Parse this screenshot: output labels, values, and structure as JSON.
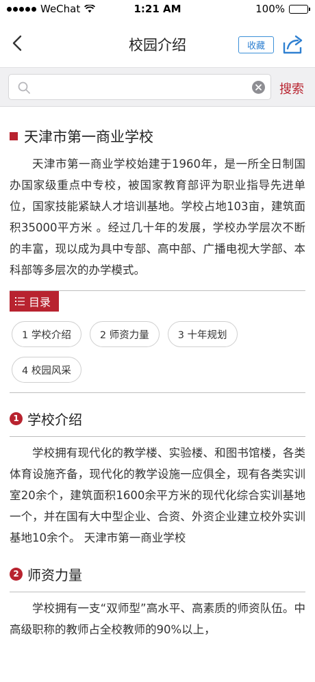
{
  "status_bar": {
    "carrier": "WeChat",
    "time": "1:21 AM",
    "battery": "100%"
  },
  "nav": {
    "title": "校园介绍",
    "favorite_label": "收藏"
  },
  "search": {
    "placeholder": "",
    "value": "",
    "button_label": "搜索"
  },
  "school": {
    "name": "天津市第一商业学校",
    "intro": "天津市第一商业学校始建于1960年，是一所全日制国办国家级重点中专校，被国家教育部评为职业指导先进单位，国家技能紧缺人才培训基地。学校占地103亩，建筑面积35000平方米 。经过几十年的发展，学校办学层次不断的丰富，现以成为具中专部、高中部、广播电视大学部、本科部等多层次的办学模式。"
  },
  "toc": {
    "label": "目录",
    "items": [
      "1 学校介绍",
      "2 师资力量",
      "3 十年规划",
      "4 校园风采"
    ]
  },
  "sections": [
    {
      "number": "1",
      "title": "学校介绍",
      "body": "学校拥有现代化的教学楼、实验楼、和图书馆楼，各类体育设施齐备，现代化的教学设施一应俱全，现有各类实训室20余个，建筑面积1600余平方米的现代化综合实训基地一个，并在国有大中型企业、合资、外资企业建立校外实训基地10余个。 天津市第一商业学校"
    },
    {
      "number": "2",
      "title": "师资力量",
      "body": "学校拥有一支“双师型”高水平、高素质的师资队伍。中高级职称的教师占全校教师的90%以上，"
    }
  ],
  "colors": {
    "accent": "#b8232f",
    "link_blue": "#2f80d1"
  },
  "icons": {
    "back": "chevron-left-icon",
    "share": "share-icon",
    "search": "search-icon",
    "clear": "clear-icon",
    "toc": "list-icon"
  }
}
